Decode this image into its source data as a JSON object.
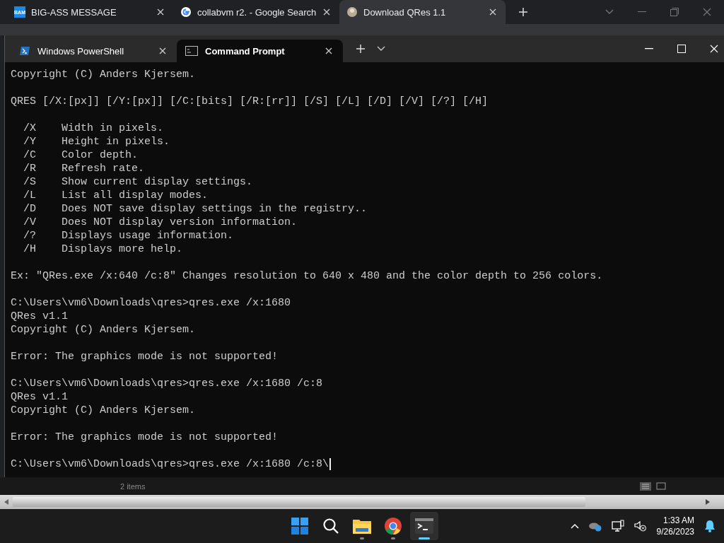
{
  "browser": {
    "tabs": [
      {
        "title": "BIG-ASS MESSAGE",
        "kind": "badge",
        "badge": "BAM",
        "selected": false
      },
      {
        "title": "collabvm r2. - Google Search",
        "kind": "google",
        "selected": false
      },
      {
        "title": "Download QRes 1.1",
        "kind": "avatar",
        "selected": true
      }
    ]
  },
  "terminal": {
    "tabs": [
      {
        "title": "Windows PowerShell",
        "kind": "powershell",
        "selected": false
      },
      {
        "title": "Command Prompt",
        "kind": "cmd",
        "selected": true
      }
    ],
    "output": [
      [
        "Copyright (C) Anders Kjersem."
      ],
      [
        "QRES [/X:[px]] [/Y:[px]] [/C:[bits] [/R:[rr]] [/S] [/L] [/D] [/V] [/?] [/H]"
      ],
      [
        "  /X    Width in pixels.",
        "  /Y    Height in pixels.",
        "  /C    Color depth.",
        "  /R    Refresh rate.",
        "  /S    Show current display settings.",
        "  /L    List all display modes.",
        "  /D    Does NOT save display settings in the registry..",
        "  /V    Does NOT display version information.",
        "  /?    Displays usage information.",
        "  /H    Displays more help."
      ],
      [
        "Ex: \"QRes.exe /x:640 /c:8\" Changes resolution to 640 x 480 and the color depth to 256 colors."
      ],
      [
        "C:\\Users\\vm6\\Downloads\\qres>qres.exe /x:1680",
        "QRes v1.1",
        "Copyright (C) Anders Kjersem."
      ],
      [
        "Error: The graphics mode is not supported!"
      ],
      [
        "C:\\Users\\vm6\\Downloads\\qres>qres.exe /x:1680 /c:8",
        "QRes v1.1",
        "Copyright (C) Anders Kjersem."
      ],
      [
        "Error: The graphics mode is not supported!"
      ]
    ],
    "input_line": "C:\\Users\\vm6\\Downloads\\qres>qres.exe /x:1680 /c:8\\"
  },
  "explorer": {
    "status": "2 items"
  },
  "taskbar": {
    "apps": [
      {
        "kind": "start",
        "selected": false
      },
      {
        "kind": "search",
        "selected": false
      },
      {
        "kind": "explorer",
        "selected": false
      },
      {
        "kind": "chrome",
        "selected": false
      },
      {
        "kind": "terminal",
        "selected": true
      }
    ],
    "time": "1:33 AM",
    "date": "9/26/2023"
  }
}
